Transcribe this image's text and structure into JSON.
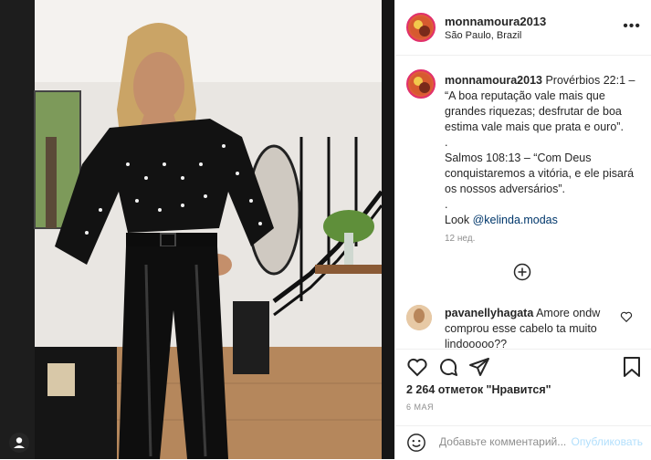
{
  "post": {
    "username": "monnamoura2013",
    "location": "São Paulo, Brazil",
    "more_icon": "more-icon"
  },
  "caption": {
    "username": "monnamoura2013",
    "lines": [
      "Provérbios 22:1 –",
      "“A boa reputação vale mais que",
      "grandes riquezas; desfrutar de boa",
      "estima vale mais que prata e ouro”.",
      ".",
      "Salmos 108:13 – “Com Deus",
      "conquistaremos a vitória, e ele pisará",
      "os nossos adversários”.",
      "."
    ],
    "look_prefix": "Look ",
    "mention": "@kelinda.modas",
    "age": "12 нед."
  },
  "comment": {
    "username": "pavanellyhagata",
    "text_line1": "Amore ondw",
    "text_line2": "comprou esse cabelo ta muito",
    "text_line3": "lindooooo??"
  },
  "actions": {
    "likes": "2 264 отметок \"Нравится\"",
    "date": "6 МАЯ"
  },
  "comment_box": {
    "placeholder": "Добавьте комментарий...",
    "publish_label": "Опубликовать"
  },
  "colors": {
    "ring": "#e1306c",
    "mention": "#00376b",
    "publish": "#b2dffc",
    "muted": "#8e8e8e"
  }
}
